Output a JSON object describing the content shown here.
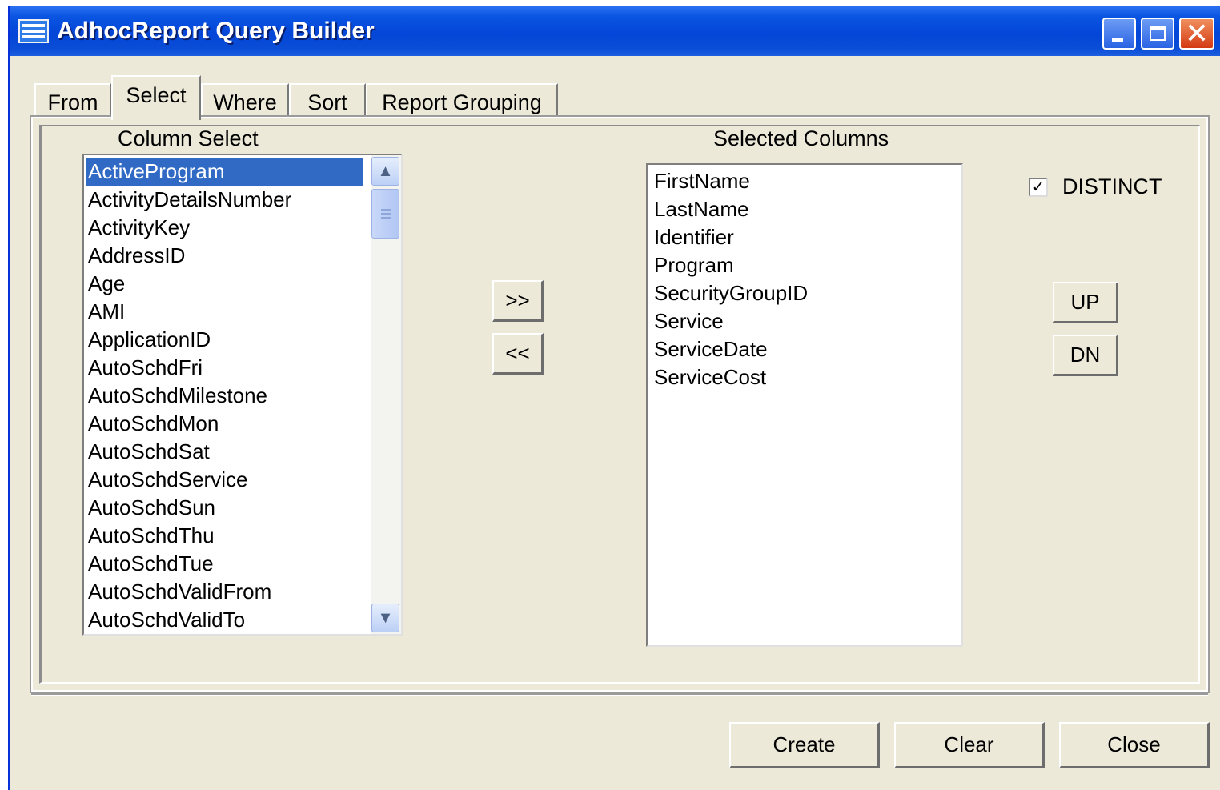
{
  "window": {
    "title": "AdhocReport Query Builder"
  },
  "tabs": [
    {
      "label": "From"
    },
    {
      "label": "Select"
    },
    {
      "label": "Where"
    },
    {
      "label": "Sort"
    },
    {
      "label": "Report Grouping"
    }
  ],
  "column_select": {
    "label": "Column Select",
    "selected_item": "ActiveProgram",
    "items": [
      "ActiveProgram",
      "ActivityDetailsNumber",
      "ActivityKey",
      "AddressID",
      "Age",
      "AMI",
      "ApplicationID",
      "AutoSchdFri",
      "AutoSchdMilestone",
      "AutoSchdMon",
      "AutoSchdSat",
      "AutoSchdService",
      "AutoSchdSun",
      "AutoSchdThu",
      "AutoSchdTue",
      "AutoSchdValidFrom",
      "AutoSchdValidTo"
    ]
  },
  "move_buttons": {
    "add": ">>",
    "remove": "<<"
  },
  "selected_columns": {
    "label": "Selected Columns",
    "items": [
      "FirstName",
      "LastName",
      "Identifier",
      "Program",
      "SecurityGroupID",
      "Service",
      "ServiceDate",
      "ServiceCost"
    ]
  },
  "distinct": {
    "label": "DISTINCT",
    "checked": true,
    "mark": "✓"
  },
  "order_buttons": {
    "up": "UP",
    "down": "DN"
  },
  "footer_buttons": {
    "create": "Create",
    "clear": "Clear",
    "close": "Close"
  },
  "icons": {
    "app": "grid-window-icon",
    "minimize": "minimize-icon",
    "maximize": "maximize-icon",
    "close": "close-icon",
    "scroll_up": "chevron-up-icon",
    "scroll_down": "chevron-down-icon"
  },
  "colors": {
    "titlebar": "#0346d8",
    "selection": "#316ac5",
    "dialog_bg": "#ece9d8"
  }
}
